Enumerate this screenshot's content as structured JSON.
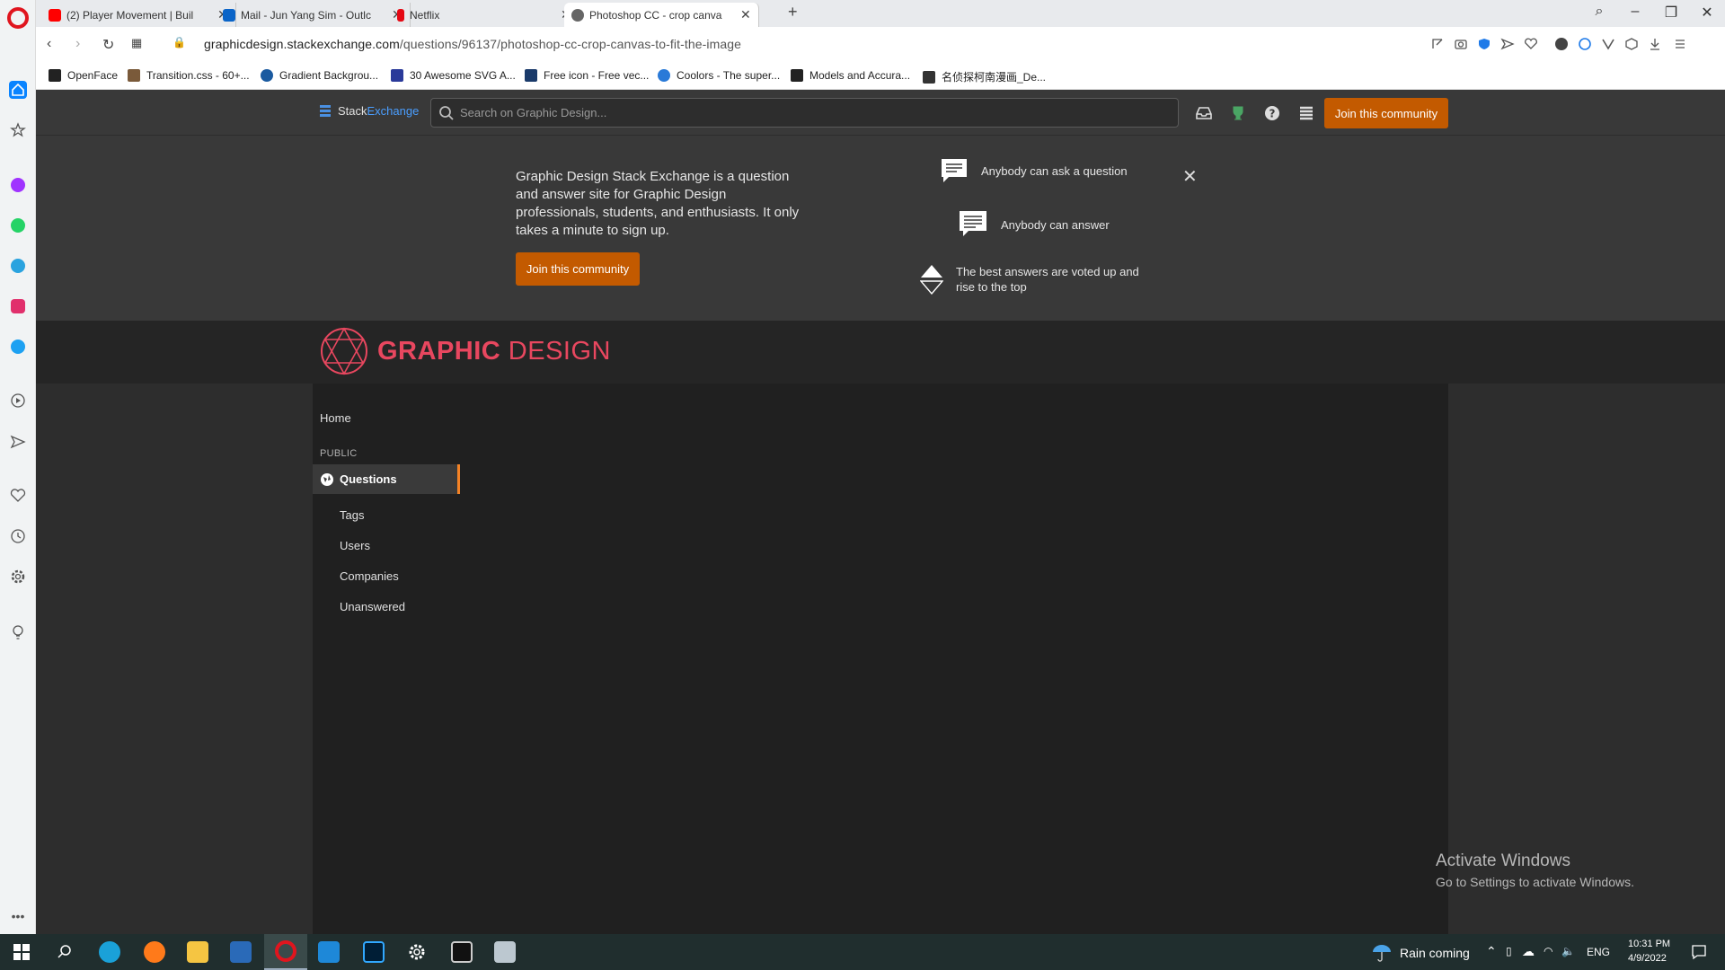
{
  "browser": {
    "tabs": [
      {
        "label": "(2) Player Movement | Buil",
        "favicon_color": "#ff0000"
      },
      {
        "label": "Mail - Jun Yang Sim - Outlc",
        "favicon_color": "#0a64c8"
      },
      {
        "label": "Netflix",
        "favicon_color": "#e50914"
      },
      {
        "label": "Photoshop CC - crop canva",
        "favicon_color": "#666666"
      }
    ],
    "new_tab_label": "+",
    "url_host": "graphicdesign.stackexchange.com",
    "url_path": "/questions/96137/photoshop-cc-crop-canvas-to-fit-the-image",
    "bookmarks": [
      {
        "label": "OpenFace",
        "color": "#222222"
      },
      {
        "label": "Transition.css - 60+...",
        "color": "#7a5a3a"
      },
      {
        "label": "Gradient Backgrou...",
        "color": "#1a5aa0"
      },
      {
        "label": "30 Awesome SVG A...",
        "color": "#2a3a9a"
      },
      {
        "label": "Free icon - Free vec...",
        "color": "#1a3a6a"
      },
      {
        "label": "Coolors - The super...",
        "color": "#2a7ad8"
      },
      {
        "label": "Models and Accura...",
        "color": "#222222"
      },
      {
        "label": "名侦探柯南漫画_De...",
        "color": "#333333"
      }
    ]
  },
  "topbar": {
    "logo_stack": "Stack",
    "logo_exchange": "Exchange",
    "search_placeholder": "Search on Graphic Design...",
    "join_label": "Join this community"
  },
  "banner": {
    "description": "Graphic Design Stack Exchange is a question and answer site for Graphic Design professionals, students, and enthusiasts. It only takes a minute to sign up.",
    "join_label": "Join this community",
    "features": [
      "Anybody can ask a question",
      "Anybody can answer",
      "The best answers are voted up and rise to the top"
    ],
    "close_glyph": "✕"
  },
  "site": {
    "name_bold": "GRAPHIC",
    "name_light": " DESIGN",
    "brand_color": "#e8475f"
  },
  "nav": {
    "home": "Home",
    "section": "PUBLIC",
    "questions": "Questions",
    "items": [
      "Tags",
      "Users",
      "Companies",
      "Unanswered"
    ]
  },
  "watermark": {
    "title": "Activate Windows",
    "subtitle": "Go to Settings to activate Windows."
  },
  "taskbar": {
    "weather": "Rain coming",
    "language": "ENG",
    "time": "10:31 PM",
    "date": "4/9/2022"
  },
  "colors": {
    "accent_orange": "#c35a00",
    "page_bg": "#2d2d2d"
  }
}
